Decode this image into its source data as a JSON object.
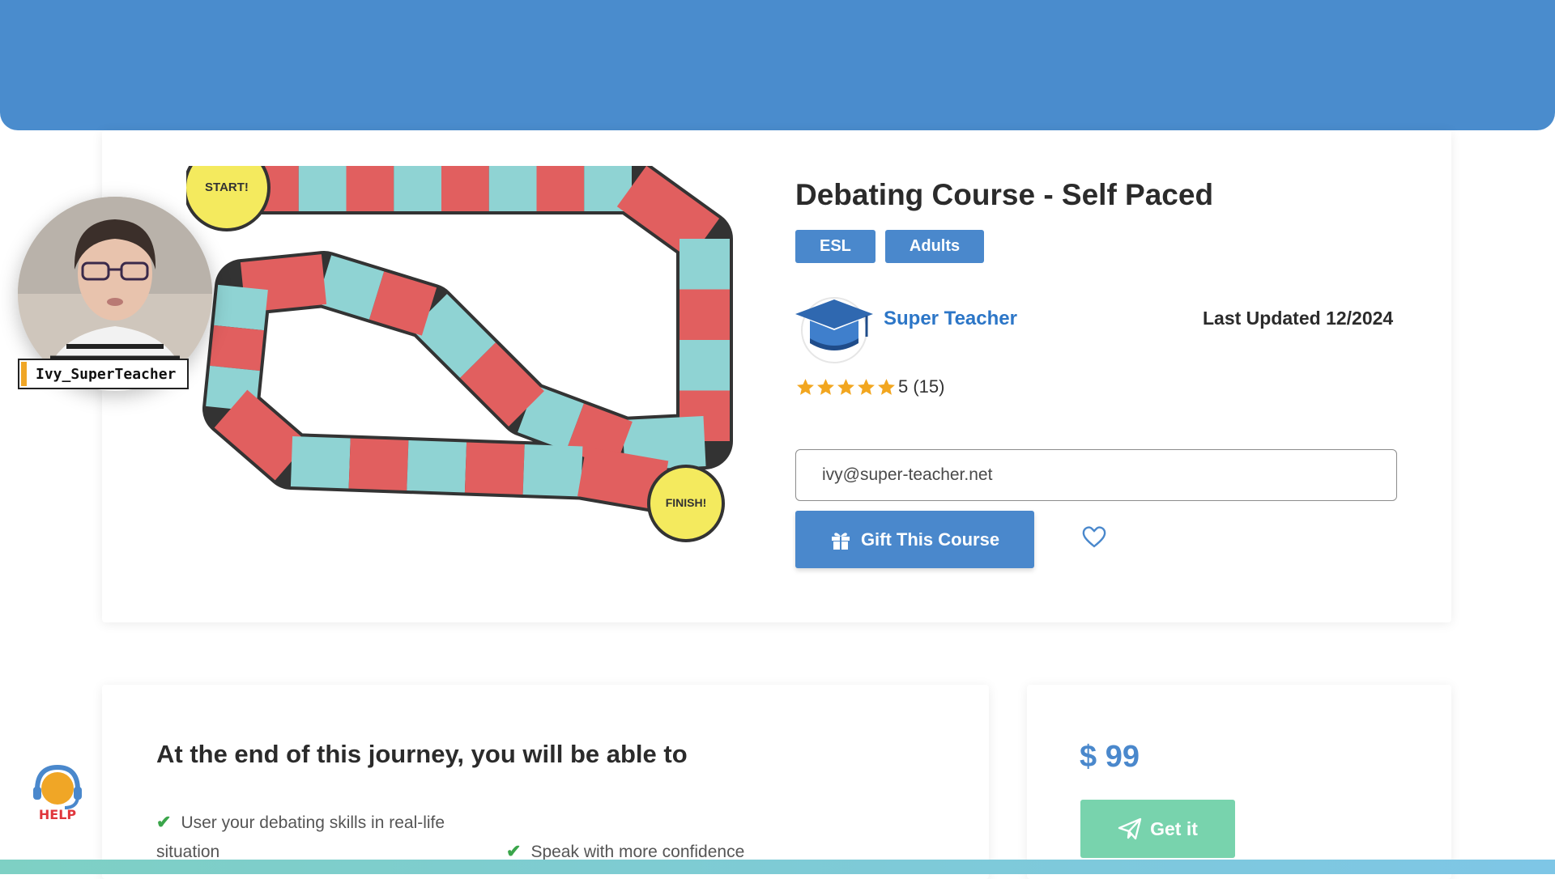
{
  "course": {
    "title": "Debating Course - Self Paced",
    "tags": [
      "ESL",
      "Adults"
    ],
    "teacher_name": "Super Teacher",
    "last_updated": "Last Updated 12/2024",
    "rating_text": "5 (15)",
    "rating_value": 5,
    "rating_max": 5
  },
  "board": {
    "start_label": "START!",
    "finish_label": "FINISH!"
  },
  "gift": {
    "email_value": "ivy@super-teacher.net",
    "button_label": "Gift This Course"
  },
  "learn": {
    "title": "At the end of this journey, you will be able to",
    "items": [
      "User your debating skills in real-life situation",
      "Speak with more confidence"
    ]
  },
  "pricing": {
    "price": "$ 99",
    "button_label": "Get it"
  },
  "webcam": {
    "username": "Ivy_SuperTeacher"
  },
  "help": {
    "label": "HELP"
  },
  "colors": {
    "topbar": "#4a8ccd",
    "accent": "#4a88cc",
    "link": "#2c76c7",
    "get_button": "#78d3ad",
    "star": "#f2a61f",
    "check": "#3aa54a",
    "board_red": "#e15f5f",
    "board_teal": "#8fd3d3"
  },
  "icons": {
    "gift_button": "gift-icon",
    "wishlist": "heart-icon",
    "get_button": "paper-plane-icon",
    "help": "headset-icon"
  }
}
